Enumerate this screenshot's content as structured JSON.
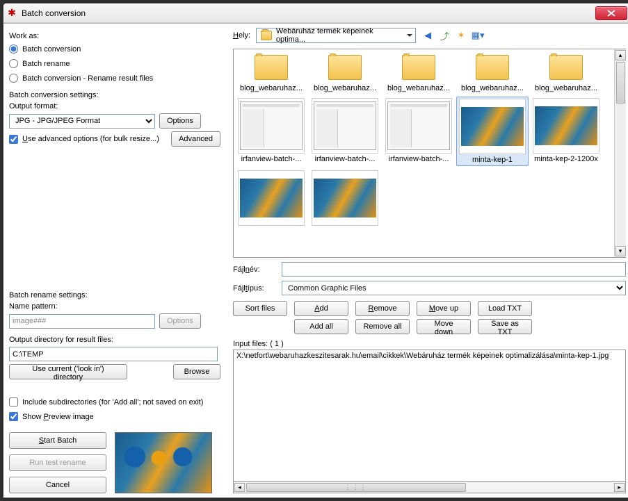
{
  "window": {
    "title": "Batch conversion"
  },
  "work_as": {
    "label": "Work as:",
    "options": [
      "Batch conversion",
      "Batch rename",
      "Batch conversion - Rename result files"
    ],
    "selected": 0
  },
  "conv": {
    "settings_label": "Batch conversion settings:",
    "output_format_label": "Output format:",
    "output_format_value": "JPG - JPG/JPEG Format",
    "options_btn": "Options",
    "adv_check_label": "Use advanced options (for bulk resize...)",
    "adv_check": true,
    "adv_btn": "Advanced"
  },
  "rename": {
    "settings_label": "Batch rename settings:",
    "name_pattern_label": "Name pattern:",
    "name_pattern_value": "image###",
    "options_btn": "Options"
  },
  "outdir": {
    "label": "Output directory for result files:",
    "value": "C:\\TEMP",
    "use_current_btn": "Use current ('look in') directory",
    "browse_btn": "Browse"
  },
  "checks": {
    "include_sub_label": "Include subdirectories (for 'Add all'; not saved on exit)",
    "include_sub": false,
    "show_preview_label": "Show Preview image",
    "show_preview": true
  },
  "actions": {
    "start": "Start Batch",
    "test": "Run test rename",
    "cancel": "Cancel"
  },
  "location": {
    "label": "Hely:",
    "folder": "Webáruház termék képeinek optima..."
  },
  "files": [
    {
      "name": "blog_webaruhaz...",
      "type": "folder"
    },
    {
      "name": "blog_webaruhaz...",
      "type": "folder"
    },
    {
      "name": "blog_webaruhaz...",
      "type": "folder"
    },
    {
      "name": "blog_webaruhaz...",
      "type": "folder"
    },
    {
      "name": "blog_webaruhaz...",
      "type": "folder"
    },
    {
      "name": "irfanview-batch-...",
      "type": "app"
    },
    {
      "name": "irfanview-batch-...",
      "type": "app"
    },
    {
      "name": "irfanview-batch-...",
      "type": "app"
    },
    {
      "name": "minta-kep-1",
      "type": "pic",
      "selected": true
    },
    {
      "name": "minta-kep-2-1200x",
      "type": "pic"
    },
    {
      "name": "",
      "type": "pic"
    },
    {
      "name": "",
      "type": "pic"
    }
  ],
  "filename": {
    "label": "Fájlnév:",
    "value": ""
  },
  "filetype": {
    "label": "Fájltípus:",
    "value": "Common Graphic Files"
  },
  "midbtns": {
    "sort": "Sort files",
    "add": "Add",
    "remove": "Remove",
    "moveup": "Move up",
    "loadtxt": "Load TXT",
    "addall": "Add all",
    "removeall": "Remove all",
    "movedown": "Move down",
    "savetxt": "Save as TXT"
  },
  "input_files": {
    "label": "Input files: ( 1 )",
    "items": [
      "X:\\netfort\\webaruhazkeszitesarak.hu\\email\\cikkek\\Webáruház termék képeinek optimalizálása\\minta-kep-1.jpg"
    ]
  }
}
